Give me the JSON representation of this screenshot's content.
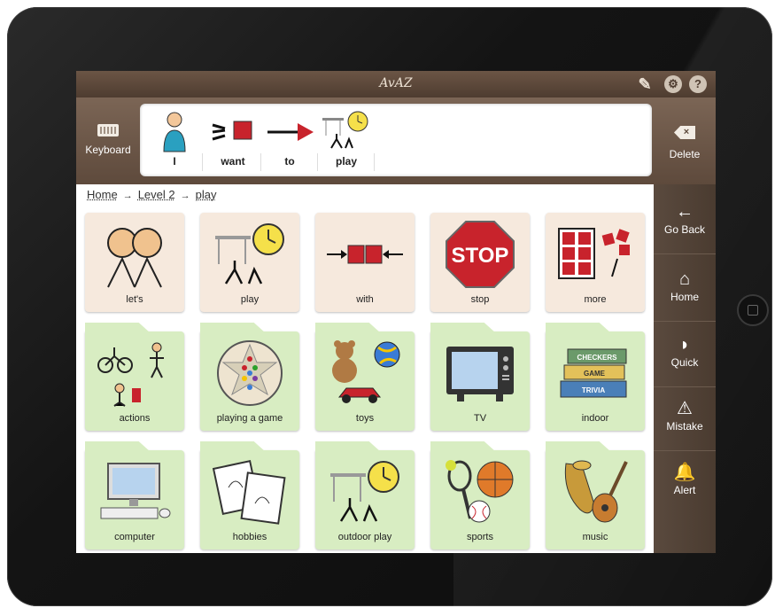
{
  "app": {
    "title": "AvAZ"
  },
  "toolbar": {
    "keyboard_label": "Keyboard",
    "delete_label": "Delete"
  },
  "sentence": [
    {
      "label": "I",
      "icon": "person-icon"
    },
    {
      "label": "want",
      "icon": "want-hands-icon"
    },
    {
      "label": "to",
      "icon": "arrow-right-icon"
    },
    {
      "label": "play",
      "icon": "play-swing-icon"
    }
  ],
  "breadcrumb": {
    "home": "Home",
    "level": "Level 2",
    "current": "play"
  },
  "sidebar": [
    {
      "label": "Go Back",
      "icon": "back-arrow-icon",
      "glyph": "←"
    },
    {
      "label": "Home",
      "icon": "home-icon",
      "glyph": "⌂"
    },
    {
      "label": "Quick",
      "icon": "speak-icon",
      "glyph": "◗"
    },
    {
      "label": "Mistake",
      "icon": "warning-icon",
      "glyph": "⚠"
    },
    {
      "label": "Alert",
      "icon": "bell-icon",
      "glyph": "🔔"
    }
  ],
  "tiles": [
    {
      "label": "let's",
      "type": "plain",
      "icon": "two-people-icon"
    },
    {
      "label": "play",
      "type": "plain",
      "icon": "play-swing-icon"
    },
    {
      "label": "with",
      "type": "plain",
      "icon": "with-squares-icon"
    },
    {
      "label": "stop",
      "type": "plain",
      "icon": "stop-sign-icon",
      "sign_text": "STOP"
    },
    {
      "label": "more",
      "type": "plain",
      "icon": "more-grid-icon"
    },
    {
      "label": "actions",
      "type": "folder",
      "icon": "actions-icon"
    },
    {
      "label": "playing a game",
      "type": "folder",
      "icon": "board-game-icon"
    },
    {
      "label": "toys",
      "type": "folder",
      "icon": "toys-icon"
    },
    {
      "label": "TV",
      "type": "folder",
      "icon": "tv-icon"
    },
    {
      "label": "indoor",
      "type": "folder",
      "icon": "board-games-stack-icon",
      "box_texts": [
        "CHECKERS",
        "GAME",
        "TRIVIA"
      ]
    },
    {
      "label": "computer",
      "type": "folder",
      "icon": "computer-icon"
    },
    {
      "label": "hobbies",
      "type": "folder",
      "icon": "hobbies-icon"
    },
    {
      "label": "outdoor play",
      "type": "folder",
      "icon": "play-swing-icon"
    },
    {
      "label": "sports",
      "type": "folder",
      "icon": "sports-balls-icon"
    },
    {
      "label": "music",
      "type": "folder",
      "icon": "instruments-icon"
    }
  ],
  "colors": {
    "header": "#5e4a3c",
    "plain_tile": "#f6e9dd",
    "folder_tile": "#d8edc2",
    "stop_red": "#c8232c"
  }
}
